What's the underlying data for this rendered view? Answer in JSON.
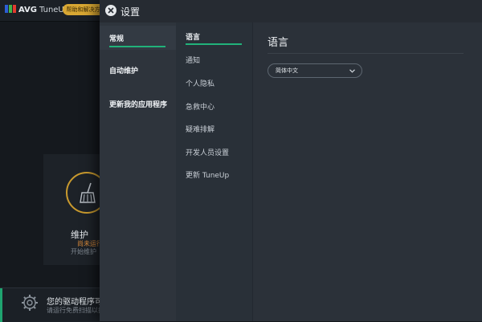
{
  "background_app": {
    "logo": "AVG",
    "app_name": "TuneUp",
    "header_button": "帮助和解决方案",
    "card_title": "维护",
    "card_status": "尚未运行",
    "card_note": "开始维护",
    "bottom_title": "您的驱动程序可能",
    "bottom_subtitle": "请运行免费扫描以找"
  },
  "settings": {
    "title": "设置",
    "categories": [
      {
        "label": "常规",
        "active": true
      },
      {
        "label": "自动维护",
        "active": false
      },
      {
        "label": "更新我的应用程序",
        "active": false
      }
    ],
    "subitems": [
      {
        "label": "语言",
        "active": true
      },
      {
        "label": "通知",
        "active": false
      },
      {
        "label": "个人隐私",
        "active": false
      },
      {
        "label": "急救中心",
        "active": false
      },
      {
        "label": "疑难排解",
        "active": false
      },
      {
        "label": "开发人员设置",
        "active": false
      },
      {
        "label": "更新 TuneUp",
        "active": false
      }
    ],
    "content": {
      "title": "语言",
      "language_value": "简体中文"
    }
  },
  "colors": {
    "accent": "#21b27a",
    "warning": "#c99a2e",
    "panel": "#2a3038"
  }
}
